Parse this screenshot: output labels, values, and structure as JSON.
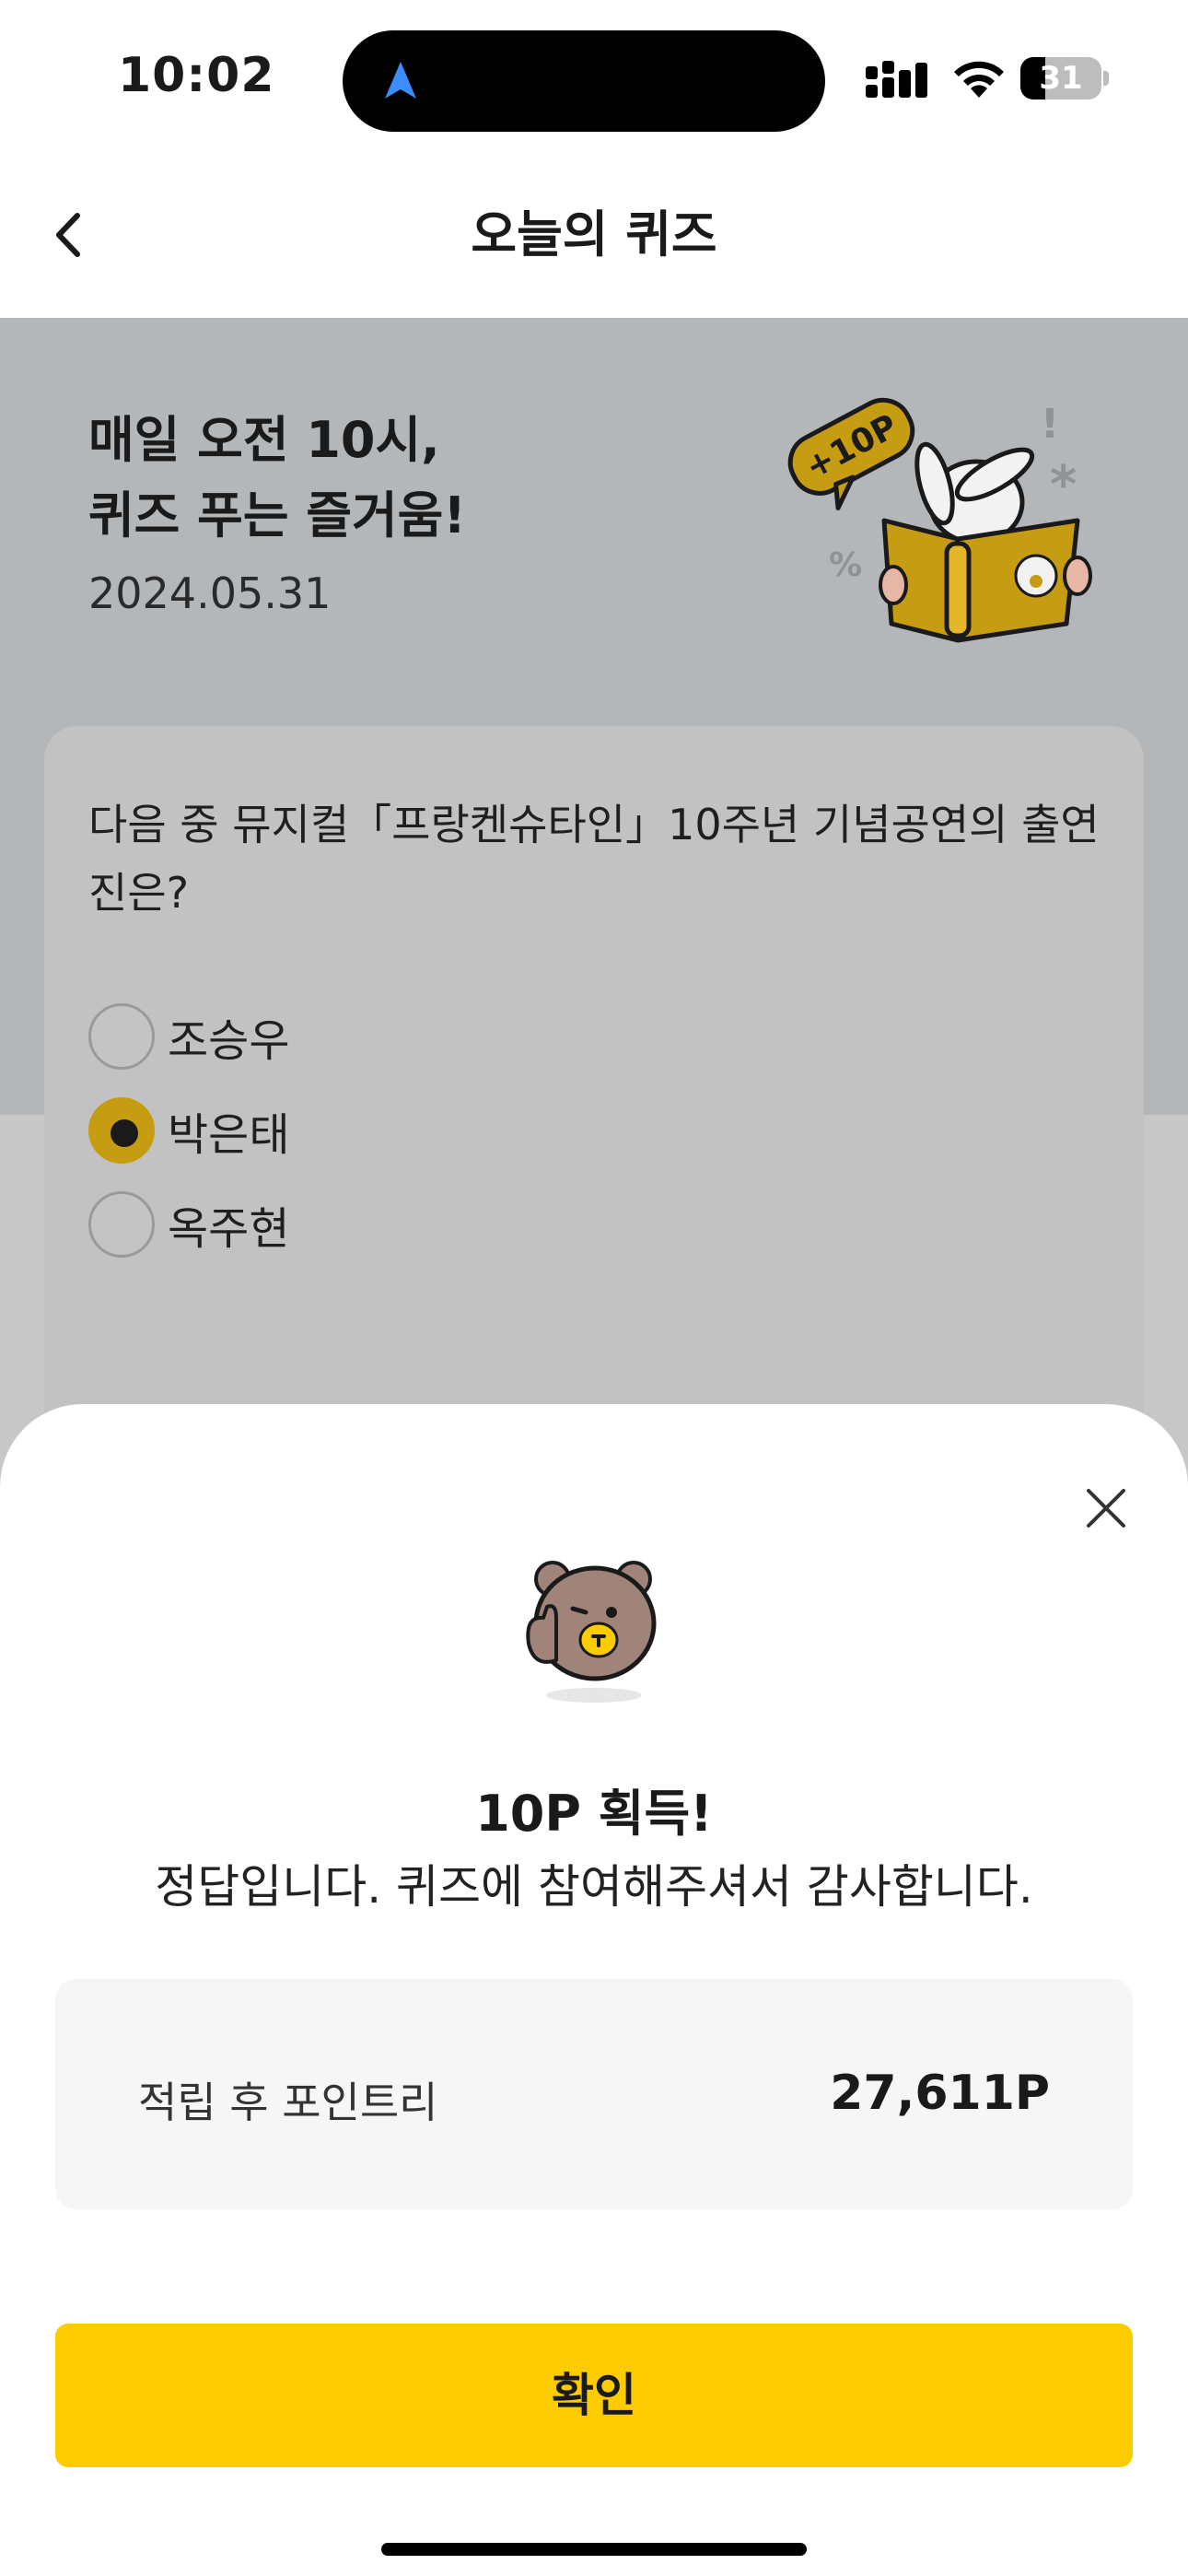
{
  "status_bar": {
    "time": "10:02",
    "battery_level": "31",
    "battery_fraction": 0.31
  },
  "header": {
    "title": "오늘의 퀴즈",
    "back_icon": "chevron-left-icon"
  },
  "hero": {
    "title_line1": "매일 오전 10시,",
    "title_line2": "퀴즈 푸는 즐거움!",
    "date": "2024.05.31",
    "badge_text": "+10P"
  },
  "quiz": {
    "question": "다음 중 뮤지컬「프랑켄슈타인」10주년 기념공연의 출연진은?",
    "options": [
      {
        "label": "조승우",
        "selected": false
      },
      {
        "label": "박은태",
        "selected": true
      },
      {
        "label": "옥주현",
        "selected": false
      }
    ]
  },
  "result_sheet": {
    "title": "10P 획득!",
    "message": "정답입니다. 퀴즈에 참여해주셔서 감사합니다.",
    "points_label": "적립 후 포인트리",
    "points_value": "27,611P",
    "confirm_label": "확인",
    "close_icon": "close-icon"
  },
  "colors": {
    "accent": "#fccc00",
    "selected_radio": "#c69d12",
    "hero_bg": "#b4b7ba"
  }
}
